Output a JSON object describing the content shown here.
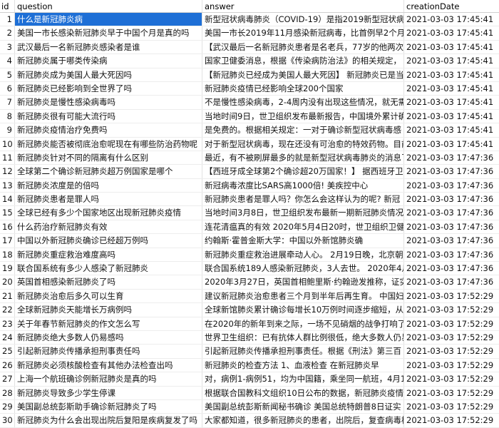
{
  "columns": [
    "id",
    "question",
    "answer",
    "creationDate"
  ],
  "rows": [
    {
      "id": "1",
      "q": "什么是新冠肺炎病",
      "a": "新型冠状病毒肺炎（COVID-19）是指2019新型冠状病",
      "d": "2021-03-03 17:45:41"
    },
    {
      "id": "2",
      "q": "美国一市长感染新冠肺炎早于中国个月是真的吗",
      "a": "美国一市长2019年11月感染新冠病毒，比首例早2个月",
      "d": "2021-03-03 17:45:41"
    },
    {
      "id": "3",
      "q": "武汉最后一名新冠肺炎感染者是谁",
      "a": "【武汉最后一名新冠肺炎患者是名老兵，77岁的他两次",
      "d": "2021-03-03 17:45:41"
    },
    {
      "id": "4",
      "q": "新冠肺炎属于哪类传染病",
      "a": "国家卫健委消息，根据《传染病防治法》的相关规定，",
      "d": "2021-03-03 17:45:41"
    },
    {
      "id": "5",
      "q": "新冠肺炎成为美国人最大死因吗",
      "a": "【新冠肺炎已经成为美国人最大死因】 新冠肺炎已是当",
      "d": "2021-03-03 17:45:41"
    },
    {
      "id": "6",
      "q": "新冠肺炎已经影响到全世界了吗",
      "a": "新冠肺炎疫情已经影响全球200个国家",
      "d": "2021-03-03 17:45:41"
    },
    {
      "id": "7",
      "q": "新冠肺炎是慢性感染病毒吗",
      "a": "不是慢性感染病毒，2-4周内没有出现这些情况，就无需",
      "d": "2021-03-03 17:45:41"
    },
    {
      "id": "8",
      "q": "新冠肺炎很有可能大流行吗",
      "a": "当地时间9日，世卫组织发布最新报告，中国境外累计确",
      "d": "2021-03-03 17:45:41"
    },
    {
      "id": "9",
      "q": "新冠肺炎疫情治疗免费吗",
      "a": "是免费的。根据相关规定：一对于确诊新型冠状病毒感",
      "d": "2021-03-03 17:45:41"
    },
    {
      "id": "10",
      "q": "新冠肺炎能否被彻底治愈呢现在有哪些防治药物呢",
      "a": "对于新型冠状病毒，现在还没有可治愈的特效药物。目前",
      "d": "2021-03-03 17:45:41"
    },
    {
      "id": "11",
      "q": "新冠肺炎针对不同的隔离有什么区别",
      "a": "最近，有不被刷屏最多的就是新型冠状病毒肺炎的消息了",
      "d": "2021-03-03 17:47:36"
    },
    {
      "id": "12",
      "q": "全球第二个确诊新冠肺炎超万例国家是哪个",
      "a": "【西班牙成全球第2个确诊超20万国家！】 据西班牙卫",
      "d": "2021-03-03 17:47:36"
    },
    {
      "id": "13",
      "q": "新冠肺炎浓度是的倍吗",
      "a": "新冠病毒浓度比SARS高1000倍! 美疾控中心",
      "d": "2021-03-03 17:47:36"
    },
    {
      "id": "14",
      "q": "新冠肺炎患者是罪人吗",
      "a": "新冠肺炎患者是罪人吗？你怎么会这样认为的呢? 新冠",
      "d": "2021-03-03 17:47:36"
    },
    {
      "id": "15",
      "q": "全球已经有多少个国家地区出现新冠肺炎疫情",
      "a": "当地时间3月8日，世卫组织发布最新一期新冠肺炎情况",
      "d": "2021-03-03 17:47:36"
    },
    {
      "id": "16",
      "q": "什么药治疗新冠肺炎有效",
      "a": "连花清瘟真的有效 2020年5月4日20时，世卫组织卫健",
      "d": "2021-03-03 17:47:36"
    },
    {
      "id": "17",
      "q": "中国以外新冠肺炎确诊已经超万例吗",
      "a": "约翰斯·霍普金斯大学：中国以外新馆肺炎确",
      "d": "2021-03-03 17:47:36"
    },
    {
      "id": "18",
      "q": "新冠肺炎重症救治难度高吗",
      "a": "新冠肺炎重症救治进展牵动人心。 2月19日晚，北京朝阳",
      "d": "2021-03-03 17:47:36"
    },
    {
      "id": "19",
      "q": "联合国系统有多少人感染了新冠肺炎",
      "a": "联合国系统189人感染新冠肺炎，3人去世。 2020年4月",
      "d": "2021-03-03 17:47:36"
    },
    {
      "id": "20",
      "q": "英国首相感染新冠肺炎了吗",
      "a": "2020年3月27日，英国首相鲍里斯·约翰逊发推称，证实",
      "d": "2021-03-03 17:47:36"
    },
    {
      "id": "21",
      "q": "新冠肺炎治愈后多久可以生育",
      "a": "建议新冠肺炎治愈患者三个月到半年后再生育。 中国妇",
      "d": "2021-03-03 17:52:29"
    },
    {
      "id": "22",
      "q": "全球新冠肺炎天能增长万病例吗",
      "a": "全球新馆肺炎累计确诊每增长10万例时间逐步缩短，从",
      "d": "2021-03-03 17:52:29"
    },
    {
      "id": "23",
      "q": "关于年春节新冠肺炎的作文怎么写",
      "a": "在2020年的新年到来之际，一场不见硝烟的战争打响了",
      "d": "2021-03-03 17:52:29"
    },
    {
      "id": "24",
      "q": "新冠肺炎绝大多数人仍易感吗",
      "a": "世界卫生组织：已有抗体人群比例很低，绝大多数人仍易",
      "d": "2021-03-03 17:52:29"
    },
    {
      "id": "25",
      "q": "引起新冠肺炎传播承担刑事责任吗",
      "a": "引起新冠肺炎传播承担刑事责任。根据《刑法》第三百",
      "d": "2021-03-03 17:52:29"
    },
    {
      "id": "26",
      "q": "新冠肺炎必须核酸检查有其他办法检查出吗",
      "a": "新冠肺炎的检查方法   1、血液检查   在新冠肺炎早",
      "d": "2021-03-03 17:52:29"
    },
    {
      "id": "27",
      "q": "上海一个航班确诊例新冠肺炎是真的吗",
      "a": "对，病例1-病例51，均为中国籍，乘坐同一航班，4月1",
      "d": "2021-03-03 17:52:29"
    },
    {
      "id": "28",
      "q": "新冠肺炎导致多少学生停课",
      "a": "根据联合国教科文组织10日公布的数据，新冠肺炎疫情",
      "d": "2021-03-03 17:52:29"
    },
    {
      "id": "29",
      "q": "美国副总统彭斯助手确诊新冠肺炎了吗",
      "a": "美国副总统彭斯新闻秘书确诊 美国总统特朗普8日证实",
      "d": "2021-03-03 17:52:29"
    },
    {
      "id": "30",
      "q": "新冠肺炎为什么会出现出院后复阳是疾病复发了吗",
      "a": "大家都知道，很多新冠肺炎的患者，出院后，复查病毒核",
      "d": "2021-03-03 17:52:29"
    }
  ]
}
